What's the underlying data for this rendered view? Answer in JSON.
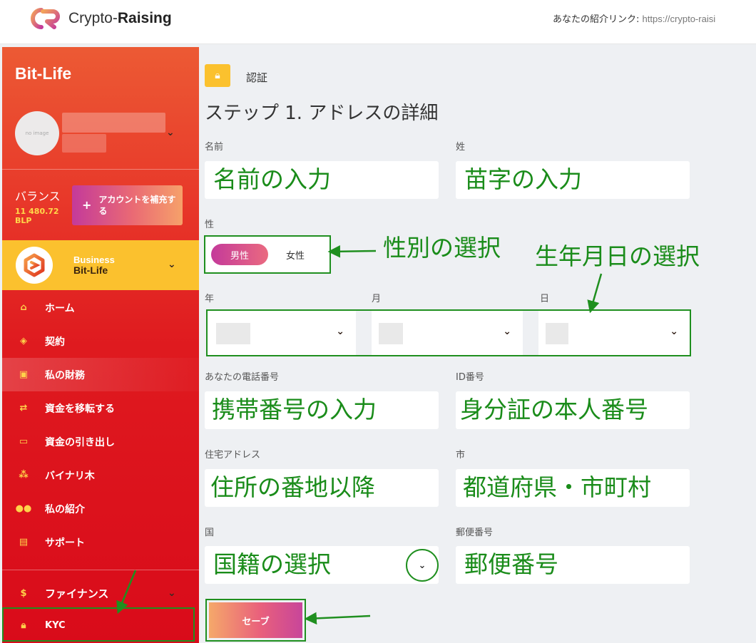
{
  "header": {
    "brand_prefix": "Crypto-",
    "brand_suffix": "Raising",
    "referral_label": "あなたの紹介リンク: ",
    "referral_url": "https://crypto-raisi"
  },
  "sidebar": {
    "brand": "Bit-Life",
    "avatar_text": "no image",
    "balance_label": "バランス",
    "balance_value_line1": "11 480.72",
    "balance_value_line2": "BLP",
    "topup_label": "アカウントを補充する",
    "business_line1": "Business",
    "business_line2": "Bit-Life",
    "nav": [
      {
        "label": "ホーム",
        "icon": "home-icon"
      },
      {
        "label": "契約",
        "icon": "cube-icon"
      },
      {
        "label": "私の財務",
        "icon": "money-icon"
      },
      {
        "label": "資金を移転する",
        "icon": "transfer-icon"
      },
      {
        "label": "資金の引き出し",
        "icon": "wallet-icon"
      },
      {
        "label": "バイナリ木",
        "icon": "tree-icon"
      },
      {
        "label": "私の紹介",
        "icon": "users-icon"
      },
      {
        "label": "サポート",
        "icon": "chat-icon"
      }
    ],
    "finance_label": "ファイナンス",
    "kyc_label": "KYC"
  },
  "main": {
    "section_label": "認証",
    "step_title": "ステップ 1. アドレスの詳細",
    "labels": {
      "first_name": "名前",
      "last_name": "姓",
      "gender": "性",
      "year": "年",
      "month": "月",
      "day": "日",
      "phone": "あなたの電話番号",
      "id_number": "ID番号",
      "address": "住宅アドレス",
      "city": "市",
      "country": "国",
      "postal": "郵便番号"
    },
    "gender_male": "男性",
    "gender_female": "女性",
    "save_label": "セーブ"
  },
  "annotations": {
    "first_name": "名前の入力",
    "last_name": "苗字の入力",
    "gender": "性別の選択",
    "birthdate": "生年月日の選択",
    "phone": "携帯番号の入力",
    "id_number": "身分証の本人番号",
    "address": "住所の番地以降",
    "city": "都道府県・市町村",
    "country": "国籍の選択",
    "postal": "郵便番号"
  },
  "colors": {
    "sidebar_top": "#ec5a34",
    "sidebar_bottom": "#d90b1a",
    "business_band": "#fbc12e",
    "annotation_green": "#1a8c1a"
  }
}
